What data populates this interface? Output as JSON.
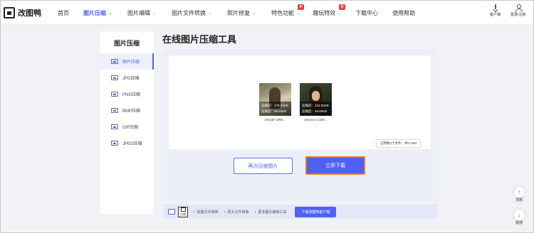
{
  "header": {
    "logo_text": "改图鸭",
    "nav": [
      {
        "label": "首页",
        "chevron": false,
        "badge": "",
        "active": false
      },
      {
        "label": "图片压缩",
        "chevron": true,
        "badge": "",
        "active": true
      },
      {
        "label": "图片编辑",
        "chevron": true,
        "badge": "",
        "active": false
      },
      {
        "label": "图片文件转换",
        "chevron": true,
        "badge": "",
        "active": false
      },
      {
        "label": "照片修复",
        "chevron": true,
        "badge": "",
        "active": false
      },
      {
        "label": "特色功能",
        "chevron": true,
        "badge": "新",
        "active": false
      },
      {
        "label": "趣玩特效",
        "chevron": true,
        "badge": "新",
        "active": false
      },
      {
        "label": "下载中心",
        "chevron": false,
        "badge": "",
        "active": false
      },
      {
        "label": "使用帮助",
        "chevron": false,
        "badge": "",
        "active": false
      }
    ],
    "client_label": "客户端",
    "login_label": "登录/注册"
  },
  "sidebar": {
    "title": "图片压缩",
    "items": [
      {
        "label": "图片压缩",
        "active": true
      },
      {
        "label": "JPG压缩",
        "active": false
      },
      {
        "label": "PNG压缩",
        "active": false
      },
      {
        "label": "BMP压缩",
        "active": false
      },
      {
        "label": "GIF压缩",
        "active": false
      },
      {
        "label": "JPEG压缩",
        "active": false
      }
    ]
  },
  "main": {
    "title": "在线图片压缩工具",
    "files": [
      {
        "before": "压缩前：176.22KB",
        "after": "压缩后：85.53KB",
        "filename": "blonde-1866..."
      },
      {
        "before": "压缩前：122.02KB",
        "after": "压缩后：49.65KB",
        "filename": "woman-11326..."
      }
    ],
    "status": "已转换2个文件，共0.13M",
    "compress_again_label": "再次压缩图片",
    "download_label": "立即下载"
  },
  "bottom_bar": {
    "icon_label": "压缩",
    "items": [
      "批量文件转换",
      "更大文件转换",
      "更多图片编辑工具"
    ],
    "download_client_label": "下载改图鸭客户端"
  },
  "floats": {
    "top_label": "顶部",
    "bottom_label": "底部"
  }
}
